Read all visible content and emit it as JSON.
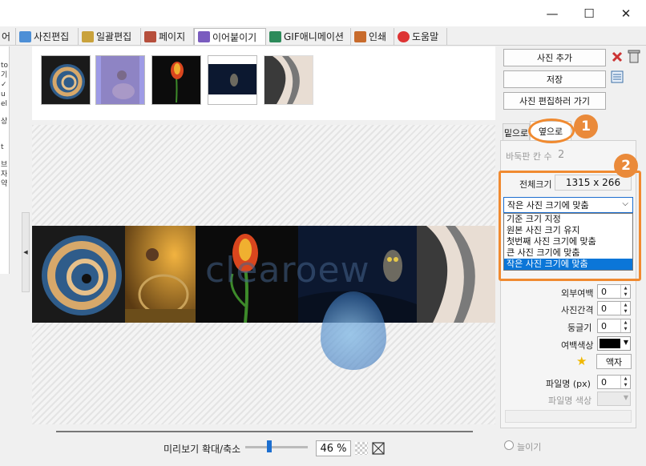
{
  "window": {
    "minimize_glyph": "—",
    "maximize_glyph": "☐",
    "close_glyph": "✕"
  },
  "tabs": [
    {
      "label": "어",
      "icon": "app-icon",
      "color": "#3a7bd5"
    },
    {
      "label": "사진편집",
      "icon": "photo-edit-icon",
      "color": "#4d8fd6"
    },
    {
      "label": "일괄편집",
      "icon": "batch-edit-icon",
      "color": "#c9a23c"
    },
    {
      "label": "페이지",
      "icon": "page-icon",
      "color": "#b64f3c"
    },
    {
      "label": "이어붙이기",
      "icon": "stitch-icon",
      "color": "#7a5cbf"
    },
    {
      "label": "GIF애니메이션",
      "icon": "gif-animation-icon",
      "color": "#2d8a5a"
    },
    {
      "label": "인쇄",
      "icon": "print-icon",
      "color": "#c86b2c"
    },
    {
      "label": "도움말",
      "icon": "help-icon",
      "color": "#d33"
    }
  ],
  "left_strip": [
    "to",
    "기",
    "✓",
    "u",
    "el",
    "",
    "상",
    "",
    "",
    "",
    "t",
    "",
    "브",
    "자",
    "약"
  ],
  "right": {
    "add_photo": "사진 추가",
    "save": "저장",
    "go_edit": "사진 편집하러 가기",
    "subtab_vertical": "밑으로",
    "subtab_horizontal": "옆으로",
    "grid_cols_label": "바둑판 칸 수",
    "grid_cols_value": "2",
    "total_size_label": "전체크기",
    "total_size_value": "1315 x 266",
    "size_mode_selected": "작은 사진 크기에 맞춤",
    "size_mode_options": [
      "기준 크기 지정",
      "원본 사진 크기 유지",
      "첫번째 사진 크기에 맞춤",
      "큰 사진 크기에 맞춤",
      "작은 사진 크기에 맞춤"
    ],
    "outer_margin_label": "외부여백",
    "outer_margin_value": "0",
    "spacing_label": "사진간격",
    "spacing_value": "0",
    "rounding_label": "둥글기",
    "rounding_value": "0",
    "margin_color_label": "여백색상",
    "margin_color": "#000000",
    "frame_button": "액자",
    "filename_label": "파일명 (px)",
    "filename_value": "0",
    "filename_color_label": "파일명 색상",
    "stretch_label": "늘이기"
  },
  "badges": {
    "one": "1",
    "two": "2"
  },
  "bottom": {
    "zoom_label": "미리보기 확대/축소",
    "zoom_value": "46 %",
    "zoom_level": 0.46
  },
  "preview": {
    "watermark": "clearoew"
  },
  "colors": {
    "accent": "#f08a30",
    "selection": "#0b76d8",
    "slider": "#1d6fd0"
  }
}
